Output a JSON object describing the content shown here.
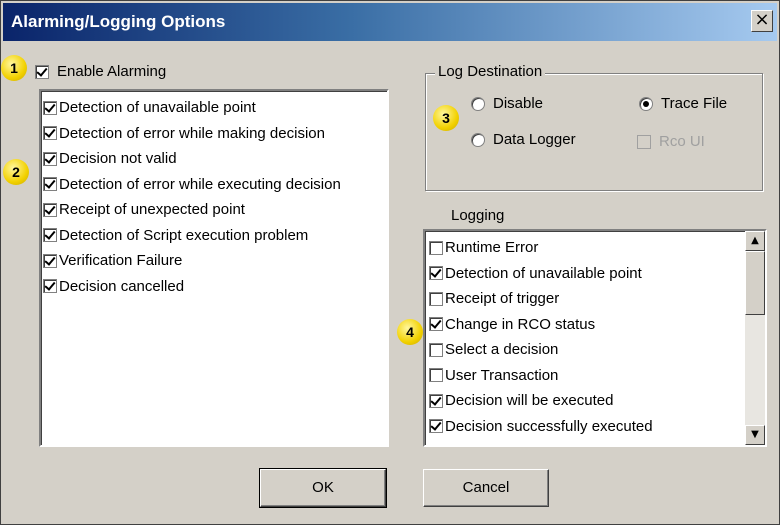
{
  "window": {
    "title": "Alarming/Logging Options",
    "close_glyph": "×"
  },
  "callouts": [
    "1",
    "2",
    "3",
    "4"
  ],
  "enable_alarming": {
    "label": "Enable Alarming",
    "checked": true
  },
  "alarm_items": [
    {
      "label": "Detection of unavailable point",
      "checked": true
    },
    {
      "label": "Detection of error while making decision",
      "checked": true
    },
    {
      "label": "Decision not valid",
      "checked": true
    },
    {
      "label": "Detection of error while executing decision",
      "checked": true
    },
    {
      "label": "Receipt of unexpected point",
      "checked": true
    },
    {
      "label": "Detection of Script execution problem",
      "checked": true
    },
    {
      "label": "Verification Failure",
      "checked": true
    },
    {
      "label": "Decision cancelled",
      "checked": true
    }
  ],
  "log_destination": {
    "legend": "Log Destination",
    "disable": "Disable",
    "trace_file": "Trace File",
    "data_logger": "Data Logger",
    "rco_ui": "Rco UI",
    "selected": "trace_file"
  },
  "logging": {
    "label": "Logging",
    "items": [
      {
        "label": "Runtime Error",
        "checked": false
      },
      {
        "label": "Detection of unavailable point",
        "checked": true
      },
      {
        "label": "Receipt of trigger",
        "checked": false
      },
      {
        "label": "Change in RCO status",
        "checked": true
      },
      {
        "label": "Select a decision",
        "checked": false
      },
      {
        "label": "User Transaction",
        "checked": false
      },
      {
        "label": "Decision will be executed",
        "checked": true
      },
      {
        "label": "Decision successfully executed",
        "checked": true
      }
    ]
  },
  "buttons": {
    "ok": "OK",
    "cancel": "Cancel"
  },
  "icons": {
    "scroll_up": "scroll-up-arrow-icon",
    "scroll_down": "scroll-down-arrow-icon",
    "up_glyph": "▲",
    "down_glyph": "▼"
  },
  "colors": {
    "titlebar_start": "#0a246a",
    "titlebar_end": "#a6caf0",
    "callout": "#f2d100",
    "face": "#d4d0c8"
  }
}
